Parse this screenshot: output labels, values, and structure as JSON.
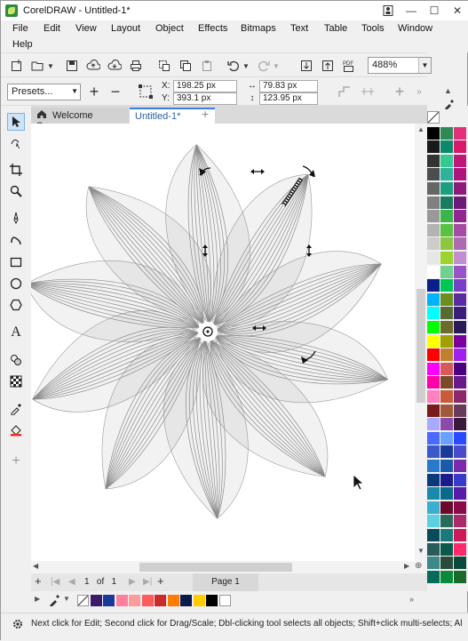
{
  "window": {
    "title": "CorelDRAW - Untitled-1*"
  },
  "menu": {
    "items": [
      "File",
      "Edit",
      "View",
      "Layout",
      "Object",
      "Effects",
      "Bitmaps",
      "Text",
      "Table",
      "Tools",
      "Window",
      "Help"
    ]
  },
  "toolbar": {
    "zoom": "488%"
  },
  "property_bar": {
    "presets": "Presets...",
    "x_label": "X:",
    "x_value": "198.25 px",
    "y_label": "Y:",
    "y_value": "393.1 px",
    "w_value": "79.83 px",
    "h_value": "123.95 px"
  },
  "tabs": {
    "welcome": "Welcome Screen",
    "document": "Untitled-1*"
  },
  "page_nav": {
    "counter": "1   of   1",
    "page_tab": "Page 1"
  },
  "status": {
    "hint": "Next click for Edit; Second click for Drag/Scale; Dbl-clicking tool selects all objects; Shift+click multi-selects; Al"
  },
  "palette_colors": [
    [
      "#000000",
      "#2d8a55",
      "#e0317a"
    ],
    [
      "#1a1a1a",
      "#0b8a6b",
      "#d9196c"
    ],
    [
      "#333333",
      "#35c98f",
      "#c0187a"
    ],
    [
      "#4d4d4d",
      "#2db39c",
      "#b0157e"
    ],
    [
      "#666666",
      "#1aa07e",
      "#8e1a7c"
    ],
    [
      "#808080",
      "#1a7a5e",
      "#6e1a7a"
    ],
    [
      "#999999",
      "#3bb54a",
      "#92278f"
    ],
    [
      "#b3b3b3",
      "#59c240",
      "#a64ca6"
    ],
    [
      "#cccccc",
      "#8cc63f",
      "#b06ab0"
    ],
    [
      "#e6e6e6",
      "#9bd42a",
      "#c38ed1"
    ],
    [
      "#ffffff",
      "#6fd18d",
      "#9a52c8"
    ],
    [
      "#0a1e8c",
      "#00c653",
      "#7a3ec8"
    ],
    [
      "#00b3ff",
      "#6a8f1f",
      "#5b2ca0"
    ],
    [
      "#00ffff",
      "#556b2f",
      "#3a1f7a"
    ],
    [
      "#00ff00",
      "#6b6b2a",
      "#2b1a5a"
    ],
    [
      "#ffff00",
      "#a0a000",
      "#7a00a0"
    ],
    [
      "#ff0000",
      "#c08030",
      "#a020f0"
    ],
    [
      "#ff00ff",
      "#d65a5a",
      "#4b0082"
    ],
    [
      "#ff00aa",
      "#7b4a2a",
      "#6a1a8a"
    ],
    [
      "#ff7fbf",
      "#c95b3a",
      "#8a2a6a"
    ],
    [
      "#7a1a1a",
      "#a05a3a",
      "#6a3a5a"
    ],
    [
      "#a9a9ff",
      "#8a4aaa",
      "#3a1a3a"
    ],
    [
      "#4a6aff",
      "#6aa0ff",
      "#2a4aff"
    ],
    [
      "#3a5acc",
      "#1a3a9a",
      "#4a4acc"
    ],
    [
      "#2a7acc",
      "#1a5aaa",
      "#7a2aaa"
    ],
    [
      "#0a3a7a",
      "#1a1a8a",
      "#3a3acc"
    ],
    [
      "#1a8aaa",
      "#0a6a8a",
      "#5a1aaa"
    ],
    [
      "#3ab0d0",
      "#6a0a2a",
      "#8a0a4a"
    ],
    [
      "#5ad0e0",
      "#2a6a5a",
      "#aa2a6a"
    ],
    [
      "#0a4a5a",
      "#1a7a7a",
      "#cc1a5a"
    ],
    [
      "#2a5a5a",
      "#0a5a4a",
      "#ff2a6a"
    ],
    [
      "#3a8a8a",
      "#2a4a3a",
      "#0a4a3a"
    ],
    [
      "#0a6a5a",
      "#0a8a3a",
      "#1a6a2a"
    ]
  ],
  "doc_palette_colors": [
    "#3a1a6a",
    "#1a3a9a",
    "#ff7fa0",
    "#ff9a9a",
    "#ff5a5a",
    "#cc2a2a",
    "#ff7a00",
    "#0a1a4a",
    "#ffcc00",
    "#000000",
    "#ffffff"
  ]
}
